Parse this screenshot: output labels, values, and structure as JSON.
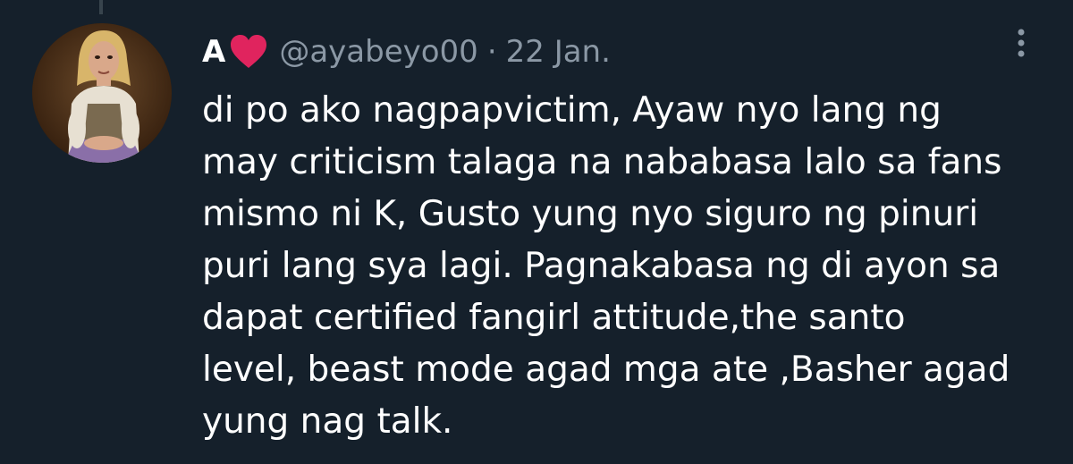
{
  "tweet": {
    "display_name": "A",
    "name_emoji": "red-heart-icon",
    "handle": "@ayabeyo00",
    "separator": "·",
    "date": "22 Jan.",
    "text_lines": [
      "di po ako nagpapvictim, Ayaw nyo lang ng",
      "may criticism talaga na nababasa lalo sa fans",
      "mismo ni K, Gusto yung nyo siguro ng pinuri",
      "puri lang sya lagi. Pagnakabasa ng di ayon sa",
      "dapat certified fangirl attitude,the santo",
      "level, beast mode agad mga ate ,Basher agad",
      "yung nag talk."
    ]
  },
  "icons": {
    "more": "more-vertical-icon",
    "avatar": "avatar-painting"
  },
  "colors": {
    "background": "#15202b",
    "text_primary": "#ffffff",
    "text_secondary": "#8b98a5",
    "heart": "#e0245e",
    "thread_line": "#38444d"
  }
}
